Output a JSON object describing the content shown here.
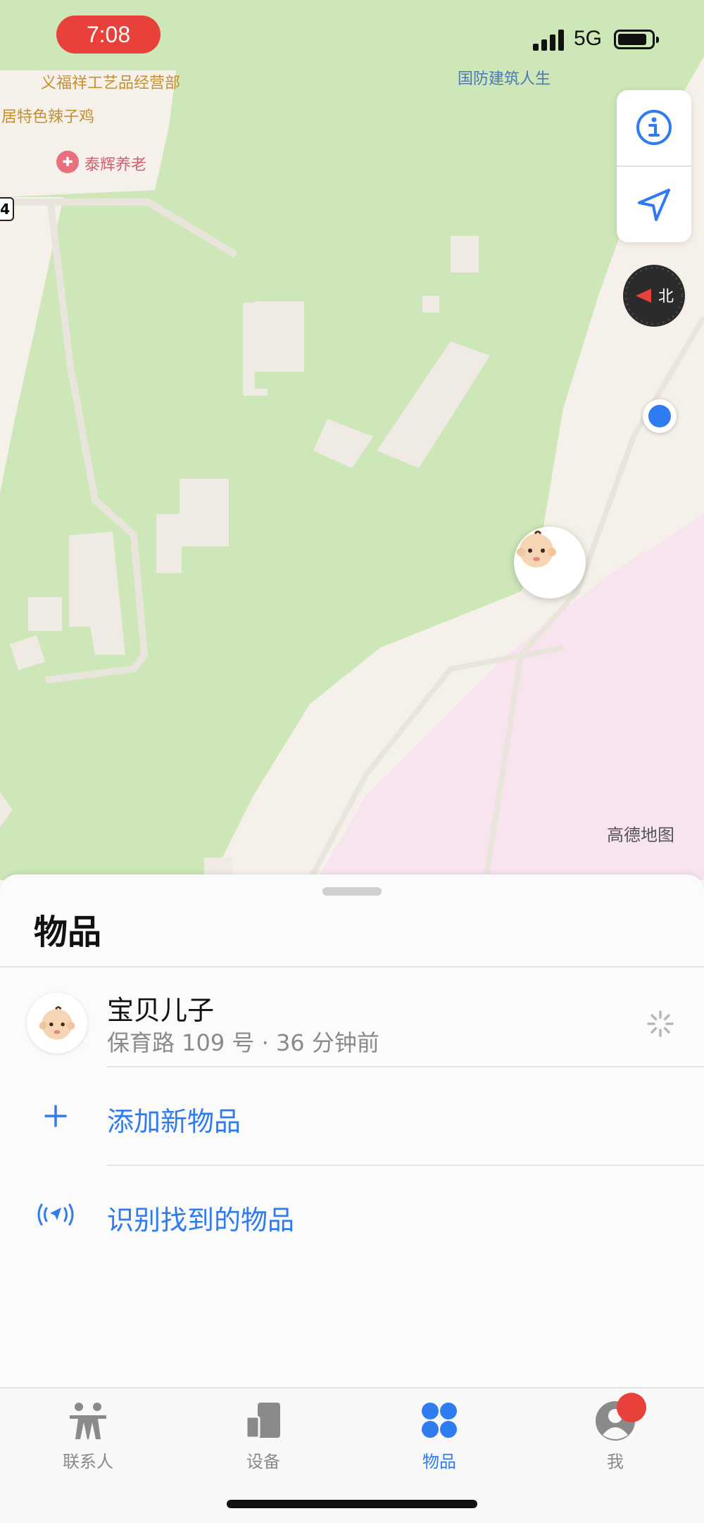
{
  "status_bar": {
    "time": "7:08",
    "network": "5G"
  },
  "map": {
    "labels": {
      "poi_top_partial": "义福祥工艺品经营部",
      "poi_chicken": "居特色辣子鸡",
      "poi_elderly": "泰辉养老",
      "poi_top_right_partial": "国防建筑人生",
      "road_shield": "4"
    },
    "attribution": "高德地图",
    "colors": {
      "park": "#cde7b8",
      "residential": "#f7e4ee",
      "land": "#f5f1ea",
      "building": "#efeae3"
    },
    "item_pin_icon": "baby-emoji-icon"
  },
  "sheet": {
    "title": "物品",
    "item": {
      "name": "宝贝儿子",
      "subtitle": "保育路 109 号 · 36 分钟前",
      "icon": "baby-emoji-icon"
    },
    "actions": [
      {
        "label": "添加新物品",
        "icon": "plus-icon"
      },
      {
        "label": "识别找到的物品",
        "icon": "airtag-signal-icon"
      }
    ]
  },
  "tabbar": {
    "tabs": [
      {
        "label": "联系人",
        "icon": "people-icon",
        "active": false
      },
      {
        "label": "设备",
        "icon": "devices-icon",
        "active": false
      },
      {
        "label": "物品",
        "icon": "items-icon",
        "active": true
      },
      {
        "label": "我",
        "icon": "me-icon",
        "active": false,
        "badge": true
      }
    ],
    "accent": "#2f7bf0",
    "badge_color": "#e8403b"
  }
}
